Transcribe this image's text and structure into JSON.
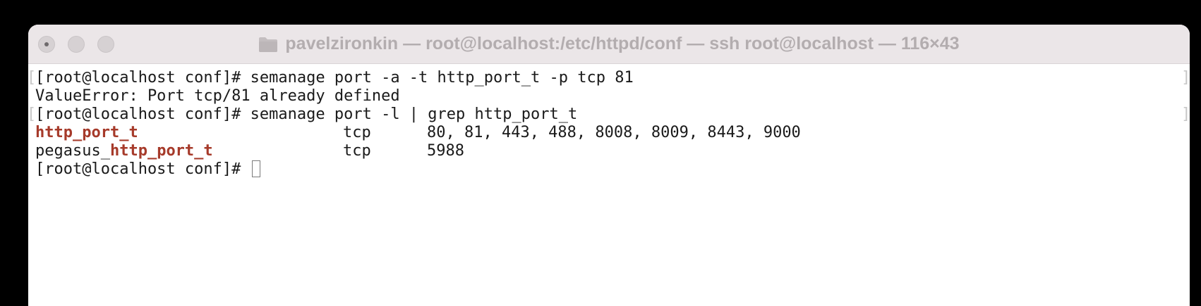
{
  "window": {
    "title": "pavelzironkin — root@localhost:/etc/httpd/conf — ssh root@localhost — 116×43",
    "folder_icon": "folder-icon"
  },
  "terminal": {
    "lines": {
      "l1": "[root@localhost conf]# semanage port -a -t http_port_t -p tcp 81",
      "l2": "ValueError: Port tcp/81 already defined",
      "l3": "[root@localhost conf]# semanage port -l | grep http_port_t",
      "l6": "[root@localhost conf]# "
    },
    "rows": [
      {
        "prefix": "",
        "match": "http_port_t",
        "proto": "tcp",
        "ports": "80, 81, 443, 488, 8008, 8009, 8443, 9000"
      },
      {
        "prefix": "pegasus_",
        "match": "http_port_t",
        "proto": "tcp",
        "ports": "5988"
      }
    ],
    "margin_marks": {
      "left": "[",
      "right": "]"
    }
  },
  "colors": {
    "highlight": "#a63a2a",
    "titlebar": "#ebe6e8",
    "title_text": "#b3adaf"
  }
}
